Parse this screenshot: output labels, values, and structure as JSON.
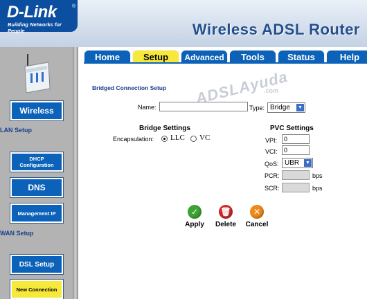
{
  "header": {
    "brand": "D-Link",
    "registered": "®",
    "tagline": "Building Networks for People",
    "product": "Wireless ADSL Router"
  },
  "tabs": [
    {
      "label": "Home"
    },
    {
      "label": "Setup"
    },
    {
      "label": "Advanced"
    },
    {
      "label": "Tools"
    },
    {
      "label": "Status"
    },
    {
      "label": "Help"
    }
  ],
  "sidebar": {
    "wireless": "Wireless",
    "lan_setup": "LAN Setup",
    "dhcp": "DHCP Configuration",
    "dns": "DNS",
    "management_ip": "Management IP",
    "wan_setup": "WAN Setup",
    "dsl_setup": "DSL Setup",
    "new_connection": "New Connection"
  },
  "form": {
    "title": "Bridged Connection Setup",
    "name_label": "Name:",
    "name_value": "",
    "type_label": "Type:",
    "type_value": "Bridge",
    "bridge_heading": "Bridge Settings",
    "encapsulation_label": "Encapsulation:",
    "llc": "LLC",
    "vc": "VC",
    "pvc_heading": "PVC Settings",
    "vpi_label": "VPI:",
    "vpi_value": "0",
    "vci_label": "VCI:",
    "vci_value": "0",
    "qos_label": "QoS:",
    "qos_value": "UBR",
    "pcr_label": "PCR:",
    "pcr_unit": "bps",
    "scr_label": "SCR:",
    "scr_unit": "bps"
  },
  "actions": {
    "apply": "Apply",
    "delete": "Delete",
    "cancel": "Cancel"
  },
  "watermark": {
    "text": "ADSLAyuda",
    "suffix": ".com"
  },
  "colors": {
    "tab_blue": "#0b62b8",
    "active_yellow": "#f7e93a",
    "heading_blue": "#1a3e8c"
  }
}
